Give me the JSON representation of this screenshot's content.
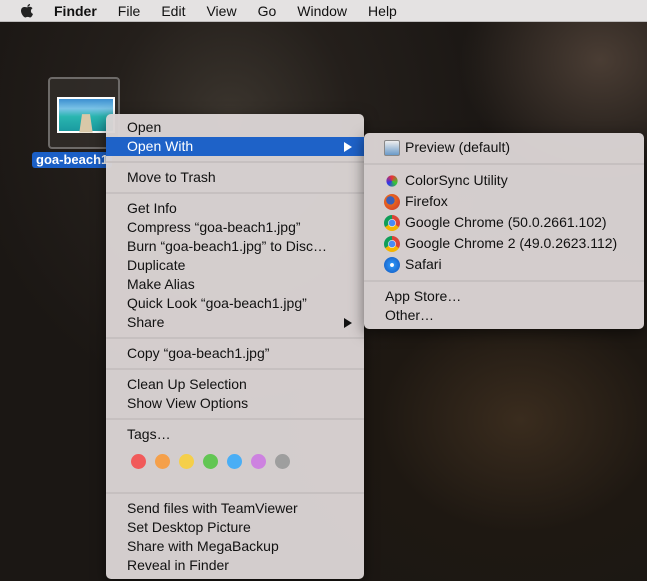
{
  "menubar": {
    "items": [
      "Finder",
      "File",
      "Edit",
      "View",
      "Go",
      "Window",
      "Help"
    ]
  },
  "desktop": {
    "file_label": "goa-beach1"
  },
  "context_menu": {
    "open": "Open",
    "open_with": "Open With",
    "move_to_trash": "Move to Trash",
    "get_info": "Get Info",
    "compress": "Compress “goa-beach1.jpg”",
    "burn": "Burn “goa-beach1.jpg” to Disc…",
    "duplicate": "Duplicate",
    "make_alias": "Make Alias",
    "quick_look": "Quick Look “goa-beach1.jpg”",
    "share": "Share",
    "copy": "Copy “goa-beach1.jpg”",
    "clean_up": "Clean Up Selection",
    "show_view_options": "Show View Options",
    "tags": "Tags…",
    "tag_colors": [
      "#f15a5a",
      "#f5a04a",
      "#f5cf4a",
      "#62c653",
      "#4aaef5",
      "#cd82e0",
      "#9e9e9e"
    ],
    "send_teamviewer": "Send files with TeamViewer",
    "set_desktop": "Set Desktop Picture",
    "share_megabackup": "Share with MegaBackup",
    "reveal": "Reveal in Finder"
  },
  "open_with_menu": {
    "preview": "Preview (default)",
    "colorsync": "ColorSync Utility",
    "firefox": "Firefox",
    "chrome": "Google Chrome (50.0.2661.102)",
    "chrome2": "Google Chrome 2 (49.0.2623.112)",
    "safari": "Safari",
    "app_store": "App Store…",
    "other": "Other…"
  }
}
